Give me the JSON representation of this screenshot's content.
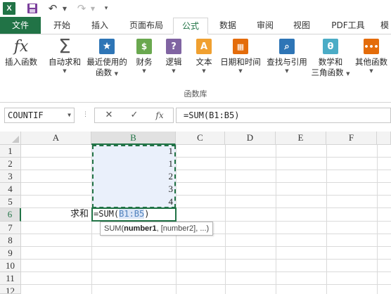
{
  "quick_access": {
    "app_icon": "excel-icon",
    "app_letter": "X",
    "save_icon": "save-icon",
    "undo_icon": "undo-icon",
    "redo_icon": "redo-icon"
  },
  "tabs": [
    {
      "label": "文件"
    },
    {
      "label": "开始"
    },
    {
      "label": "插入"
    },
    {
      "label": "页面布局"
    },
    {
      "label": "公式"
    },
    {
      "label": "数据"
    },
    {
      "label": "审阅"
    },
    {
      "label": "视图"
    },
    {
      "label": "PDF工具"
    },
    {
      "label": "模"
    }
  ],
  "active_tab": "公式",
  "ribbon": {
    "buttons": [
      {
        "label": "插入函数",
        "icon": "fx-icon"
      },
      {
        "label": "自动求和",
        "icon": "sigma-icon"
      },
      {
        "label": "最近使用的",
        "label2": "函数",
        "icon": "star-icon"
      },
      {
        "label": "财务",
        "icon": "financial-icon"
      },
      {
        "label": "逻辑",
        "icon": "logical-icon"
      },
      {
        "label": "文本",
        "icon": "text-icon"
      },
      {
        "label": "日期和时间",
        "icon": "calendar-icon"
      },
      {
        "label": "查找与引用",
        "icon": "lookup-icon"
      },
      {
        "label": "数学和",
        "label2": "三角函数",
        "icon": "math-icon"
      },
      {
        "label": "其他函数",
        "icon": "more-functions-icon"
      }
    ],
    "group_label": "函数库",
    "colors": {
      "brand": "#217346",
      "blue": "#2e75b6",
      "purple": "#8064a2",
      "orange": "#f0a030",
      "red": "#e46c0a",
      "teal": "#4bacc6"
    }
  },
  "formula_bar": {
    "name_box": "COUNTIF",
    "cancel_symbol": "✕",
    "enter_symbol": "✓",
    "fx_label": "fx",
    "formula": "=SUM(B1:B5)"
  },
  "grid": {
    "columns": [
      "A",
      "B",
      "C",
      "D",
      "E",
      "F"
    ],
    "rows": [
      "1",
      "2",
      "3",
      "4",
      "5",
      "6",
      "7",
      "8",
      "9",
      "10",
      "11",
      "12"
    ],
    "b_values": [
      "1",
      "1",
      "2",
      "3",
      "4"
    ],
    "a6_label": "求和",
    "editing": {
      "prefix": "=SUM(",
      "reference": "B1:B5",
      "suffix": ")"
    },
    "tooltip": {
      "func": "SUM(",
      "arg1": "number1",
      "rest": ", [number2], ...)"
    }
  }
}
